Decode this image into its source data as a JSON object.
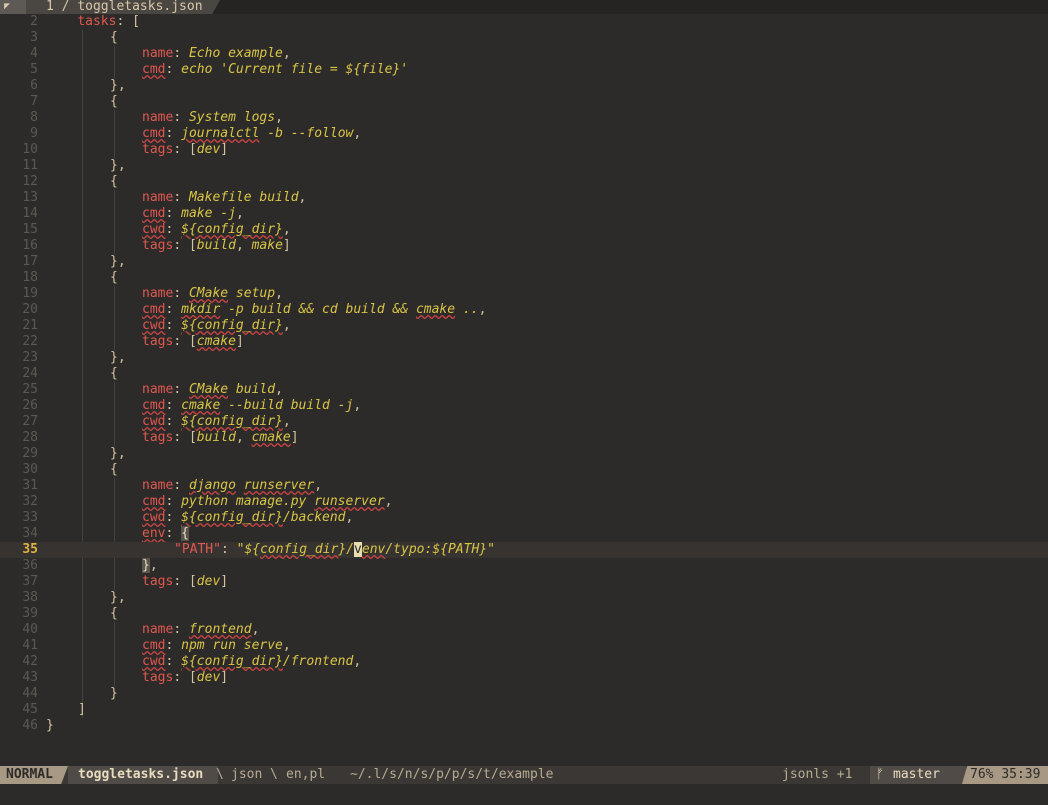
{
  "tabline": {
    "icon": "◤",
    "tab_number": "1",
    "tab_separator": " / ",
    "tab_title": "toggletasks.json"
  },
  "editor": {
    "cursor_line": 35,
    "lines": [
      {
        "n": "2"
      },
      {
        "n": "3"
      },
      {
        "n": "4"
      },
      {
        "n": "5"
      },
      {
        "n": "6"
      },
      {
        "n": "7"
      },
      {
        "n": "8"
      },
      {
        "n": "9"
      },
      {
        "n": "10"
      },
      {
        "n": "11"
      },
      {
        "n": "12"
      },
      {
        "n": "13"
      },
      {
        "n": "14"
      },
      {
        "n": "15"
      },
      {
        "n": "16"
      },
      {
        "n": "17"
      },
      {
        "n": "18"
      },
      {
        "n": "19"
      },
      {
        "n": "20"
      },
      {
        "n": "21"
      },
      {
        "n": "22"
      },
      {
        "n": "23"
      },
      {
        "n": "24"
      },
      {
        "n": "25"
      },
      {
        "n": "26"
      },
      {
        "n": "27"
      },
      {
        "n": "28"
      },
      {
        "n": "29"
      },
      {
        "n": "30"
      },
      {
        "n": "31"
      },
      {
        "n": "32"
      },
      {
        "n": "33"
      },
      {
        "n": "34"
      },
      {
        "n": "35"
      },
      {
        "n": "36"
      },
      {
        "n": "37"
      },
      {
        "n": "38"
      },
      {
        "n": "39"
      },
      {
        "n": "40"
      },
      {
        "n": "41"
      },
      {
        "n": "42"
      },
      {
        "n": "43"
      },
      {
        "n": "44"
      },
      {
        "n": "45"
      },
      {
        "n": "46"
      }
    ],
    "text": {
      "l2": "tasks",
      "l2b": ": [",
      "open": "{",
      "close": "},",
      "close_last": "}",
      "name": "name",
      "cmd": "cmd",
      "cwd": "cwd",
      "tags": "tags",
      "env": "env",
      "colon": ": ",
      "comma": ",",
      "t1_name": "Echo example",
      "t1_cmd": "echo 'Current file = ${file}'",
      "t2_name": "System logs",
      "t2_cmd_a": "journalctl",
      "t2_cmd_b": " -b --follow",
      "t2_tag": "dev",
      "t3_name": "Makefile build",
      "t3_cmd": "make -j",
      "t3_cwd": "${config_dir}",
      "t3_tag1": "build",
      "t3_tag2": "make",
      "t4_name_a": "CMake",
      "t4_name_b": " setup",
      "t4_cmd_a": "mkdir",
      "t4_cmd_b": " -p build && cd build && ",
      "t4_cmd_c": "cmake",
      "t4_cmd_d": " ..",
      "t4_cwd": "${config_dir}",
      "t4_tag": "cmake",
      "t5_name_a": "CMake",
      "t5_name_b": " build",
      "t5_cmd_a": "cmake",
      "t5_cmd_b": " --build build -j",
      "t5_cwd": "${config_dir}",
      "t5_tag1": "build",
      "t5_tag2": "cmake",
      "t6_name_a": "django",
      "t6_name_b": " ",
      "t6_name_c": "runserver",
      "t6_cmd_a": "python manage.py ",
      "t6_cmd_b": "runserver",
      "t6_cwd_a": "${config_dir}",
      "t6_cwd_b": "/backend",
      "env_key": "\"PATH\"",
      "env_val_a": "\"${",
      "env_val_b": "config_dir",
      "env_val_c": "}/",
      "env_val_cursor": "v",
      "env_val_d": "env",
      "env_val_e": "/typo:${PATH}\"",
      "t6_tag": "dev",
      "t7_name": "frontend",
      "t7_cmd": "npm run serve",
      "t7_cwd_a": "${config_dir}",
      "t7_cwd_b": "/frontend",
      "t7_tag": "dev",
      "lb": "[",
      "rb": "]",
      "sep": ", ",
      "close_list": "]",
      "close_obj": "}"
    }
  },
  "statusline": {
    "mode": "NORMAL",
    "filename": "toggletasks.json",
    "filetype": "json",
    "spelllang": "en,pl",
    "sep": "\\",
    "cwd": "~/.l/s/n/s/p/p/s/t/example",
    "lsp": "jsonls +1",
    "branch_icon": "ᚠ",
    "branch": "master",
    "percent": "76%",
    "position": "35:39"
  }
}
